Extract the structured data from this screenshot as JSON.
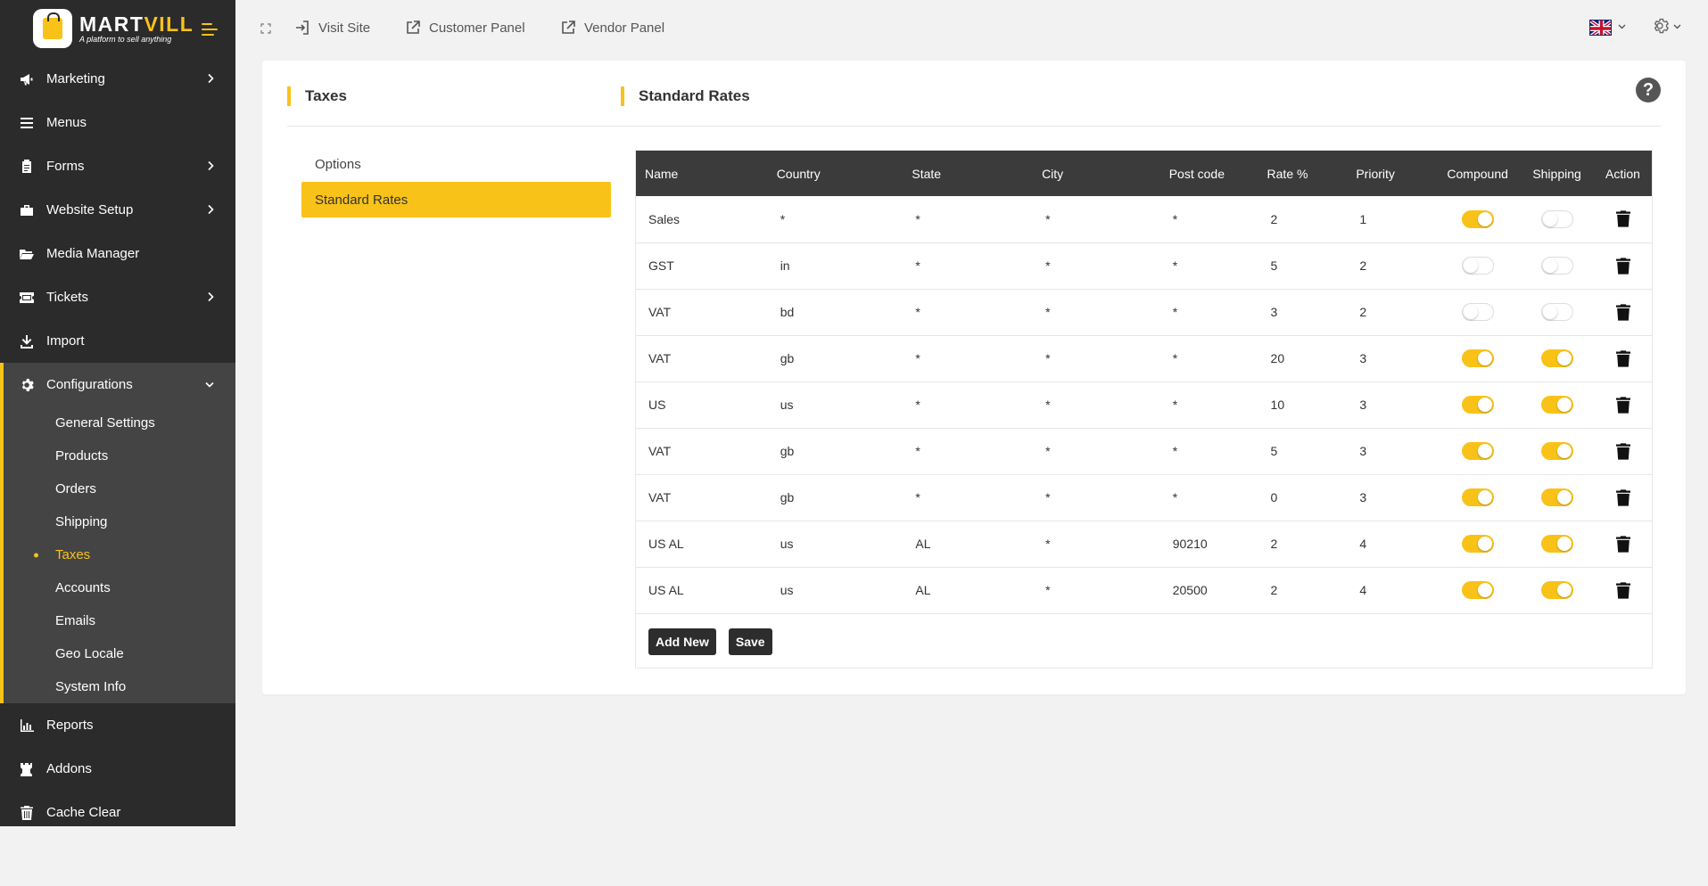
{
  "brand": {
    "name_a": "MART",
    "name_b": "VILL",
    "tagline": "A platform to sell anything"
  },
  "sidebar": {
    "items": [
      {
        "label": "Marketing",
        "icon": "megaphone-icon",
        "has_children": true
      },
      {
        "label": "Menus",
        "icon": "list-icon",
        "has_children": false
      },
      {
        "label": "Forms",
        "icon": "clipboard-icon",
        "has_children": true
      },
      {
        "label": "Website Setup",
        "icon": "briefcase-icon",
        "has_children": true
      },
      {
        "label": "Media Manager",
        "icon": "folder-open-icon",
        "has_children": false
      },
      {
        "label": "Tickets",
        "icon": "ticket-icon",
        "has_children": true
      },
      {
        "label": "Import",
        "icon": "download-icon",
        "has_children": false
      }
    ],
    "config": {
      "label": "Configurations",
      "icon": "gear-icon",
      "children": [
        {
          "label": "General Settings",
          "active": false
        },
        {
          "label": "Products",
          "active": false
        },
        {
          "label": "Orders",
          "active": false
        },
        {
          "label": "Shipping",
          "active": false
        },
        {
          "label": "Taxes",
          "active": true
        },
        {
          "label": "Accounts",
          "active": false
        },
        {
          "label": "Emails",
          "active": false
        },
        {
          "label": "Geo Locale",
          "active": false
        },
        {
          "label": "System Info",
          "active": false
        }
      ]
    },
    "bottom_items": [
      {
        "label": "Reports",
        "icon": "bar-chart-icon"
      },
      {
        "label": "Addons",
        "icon": "chess-rook-icon"
      },
      {
        "label": "Cache Clear",
        "icon": "trash-icon"
      }
    ]
  },
  "topbar": {
    "visit_site": "Visit Site",
    "customer_panel": "Customer Panel",
    "vendor_panel": "Vendor Panel",
    "language_icon": "uk-flag-icon"
  },
  "main": {
    "left_title": "Taxes",
    "right_title": "Standard Rates",
    "tabs": [
      {
        "label": "Options",
        "active": false
      },
      {
        "label": "Standard Rates",
        "active": true
      }
    ],
    "table": {
      "headers": [
        "Name",
        "Country",
        "State",
        "City",
        "Post code",
        "Rate %",
        "Priority",
        "Compound",
        "Shipping",
        "Action"
      ],
      "rows": [
        {
          "name": "Sales",
          "country": "*",
          "state": "*",
          "city": "*",
          "postcode": "*",
          "rate": "2",
          "priority": "1",
          "compound": true,
          "shipping": false
        },
        {
          "name": "GST",
          "country": "in",
          "state": "*",
          "city": "*",
          "postcode": "*",
          "rate": "5",
          "priority": "2",
          "compound": false,
          "shipping": false
        },
        {
          "name": "VAT",
          "country": "bd",
          "state": "*",
          "city": "*",
          "postcode": "*",
          "rate": "3",
          "priority": "2",
          "compound": false,
          "shipping": false
        },
        {
          "name": "VAT",
          "country": "gb",
          "state": "*",
          "city": "*",
          "postcode": "*",
          "rate": "20",
          "priority": "3",
          "compound": true,
          "shipping": true
        },
        {
          "name": "US",
          "country": "us",
          "state": "*",
          "city": "*",
          "postcode": "*",
          "rate": "10",
          "priority": "3",
          "compound": true,
          "shipping": true
        },
        {
          "name": "VAT",
          "country": "gb",
          "state": "*",
          "city": "*",
          "postcode": "*",
          "rate": "5",
          "priority": "3",
          "compound": true,
          "shipping": true
        },
        {
          "name": "VAT",
          "country": "gb",
          "state": "*",
          "city": "*",
          "postcode": "*",
          "rate": "0",
          "priority": "3",
          "compound": true,
          "shipping": true
        },
        {
          "name": "US AL",
          "country": "us",
          "state": "AL",
          "city": "*",
          "postcode": "90210",
          "rate": "2",
          "priority": "4",
          "compound": true,
          "shipping": true
        },
        {
          "name": "US AL",
          "country": "us",
          "state": "AL",
          "city": "*",
          "postcode": "20500",
          "rate": "2",
          "priority": "4",
          "compound": true,
          "shipping": true
        }
      ]
    },
    "buttons": {
      "add_new": "Add New",
      "save": "Save"
    }
  },
  "colors": {
    "accent": "#f9c218",
    "sidebar_bg": "#2b2b2b",
    "table_header_bg": "#3b3b3b"
  }
}
